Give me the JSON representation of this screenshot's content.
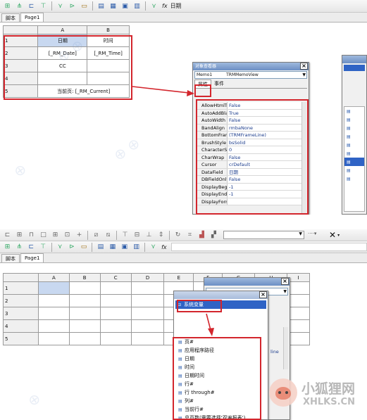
{
  "top": {
    "toolbar": {
      "fx_label": "fx",
      "text_value": "日期"
    },
    "tabs": [
      "脚本",
      "Page1"
    ],
    "grid": {
      "columns": [
        "A",
        "B"
      ],
      "rows": [
        {
          "num": "1",
          "a": "日期",
          "b": "时间"
        },
        {
          "num": "2",
          "a": "[_RM_Date]",
          "b": "[_RM_Time]"
        },
        {
          "num": "3",
          "a": "CC",
          "b": ""
        },
        {
          "num": "4",
          "a": "",
          "b": ""
        },
        {
          "num": "5",
          "merged": "当前页: [_RM_Current]"
        }
      ]
    },
    "inspector": {
      "title": "对象查看器",
      "object_combo": "Memo1",
      "object_class": "TRMMemoView",
      "tabs": [
        "属性",
        "事件"
      ],
      "props": [
        {
          "name": "AllowHtmlTag",
          "value": "False"
        },
        {
          "name": "AutoAddBlank",
          "value": "True"
        },
        {
          "name": "AutoWidth",
          "value": "False"
        },
        {
          "name": "BandAlign",
          "value": "rmbaNone"
        },
        {
          "name": "BottomFrame",
          "value": "(TRMFrameLine)"
        },
        {
          "name": "BrushStyle",
          "value": "bsSolid"
        },
        {
          "name": "CharacterSpacing",
          "value": "0"
        },
        {
          "name": "CharWrap",
          "value": "False"
        },
        {
          "name": "Cursor",
          "value": "crDefault"
        },
        {
          "name": "DataField",
          "value": "日期"
        },
        {
          "name": "DBFieldOnly",
          "value": "False"
        },
        {
          "name": "DisplayBeginLine",
          "value": "-1"
        },
        {
          "name": "DisplayEndLine",
          "value": "-1"
        },
        {
          "name": "DisplayFormat",
          "value": ""
        }
      ]
    }
  },
  "bottom": {
    "toolbar": {
      "fx_label": "fx"
    },
    "tabs": [
      "脚本",
      "Page1"
    ],
    "grid": {
      "columns": [
        "A",
        "B",
        "C",
        "D",
        "E",
        "F",
        "G",
        "H",
        "I"
      ],
      "rows": [
        "1",
        "2",
        "3",
        "4",
        "5"
      ]
    },
    "inspector_fragment": "line",
    "tree": {
      "root": "系统变量",
      "items": [
        "页#",
        "应用程序路径",
        "日期",
        "时间",
        "日期时间",
        "行#",
        "行 through#",
        "列#",
        "当前行#",
        "总页数(需要选择'双遍报表')"
      ]
    }
  },
  "watermark": {
    "logo_text": "小狐狸网",
    "url_text": "XHLKS.CN"
  },
  "colors": {
    "highlight_red": "#d3262d",
    "selection_blue": "#2f63c5",
    "title_bar": "#6c8fc4"
  }
}
